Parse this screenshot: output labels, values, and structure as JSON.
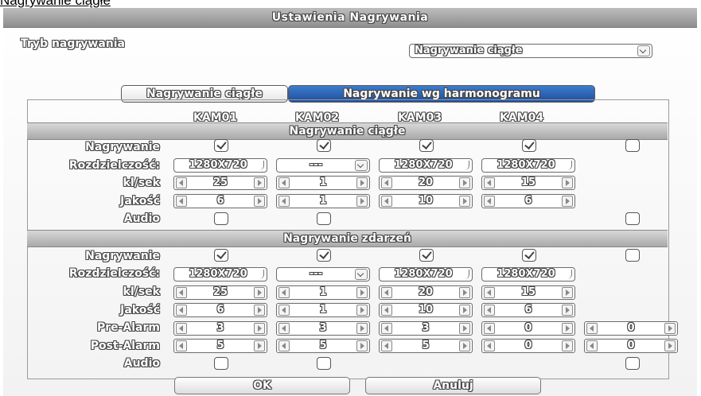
{
  "caption": "Nagrywanie ciągłe",
  "window_title": "Ustawienia Nagrywania",
  "mode": {
    "label": "Tryb nagrywania",
    "value": "Nagrywanie ciągłe"
  },
  "tabs": [
    {
      "label": "Nagrywanie ciągłe",
      "active": true
    },
    {
      "label": "Nagrywanie wg harmonogramu",
      "active": false
    }
  ],
  "cameras": [
    "KAM01",
    "KAM02",
    "KAM03",
    "KAM04"
  ],
  "continuous": {
    "title": "Nagrywanie ciągłe",
    "labels": {
      "record": "Nagrywanie",
      "resolution": "Rozdzielczość:",
      "fps": "kl/sek",
      "quality": "Jakość",
      "audio": "Audio"
    },
    "record": [
      true,
      true,
      true,
      true,
      false
    ],
    "resolution": [
      "1280X720",
      "---",
      "1280X720",
      "1280X720"
    ],
    "fps": [
      "25",
      "1",
      "20",
      "15"
    ],
    "quality": [
      "6",
      "1",
      "10",
      "6"
    ],
    "audio": [
      false,
      false,
      false
    ]
  },
  "event": {
    "title": "Nagrywanie zdarzeń",
    "labels": {
      "record": "Nagrywanie",
      "resolution": "Rozdzielczość:",
      "fps": "kl/sek",
      "quality": "Jakość",
      "pre": "Pre-Alarm",
      "post": "Post-Alarm",
      "audio": "Audio"
    },
    "record": [
      true,
      true,
      true,
      true,
      false
    ],
    "resolution": [
      "1280X720",
      "---",
      "1280X720",
      "1280X720"
    ],
    "fps": [
      "25",
      "1",
      "20",
      "15"
    ],
    "quality": [
      "6",
      "1",
      "10",
      "6"
    ],
    "pre": [
      "3",
      "3",
      "3",
      "0",
      "0"
    ],
    "post": [
      "5",
      "5",
      "5",
      "0",
      "0"
    ],
    "audio": [
      false,
      false,
      false
    ]
  },
  "buttons": {
    "ok": "OK",
    "cancel": "Anuluj"
  }
}
